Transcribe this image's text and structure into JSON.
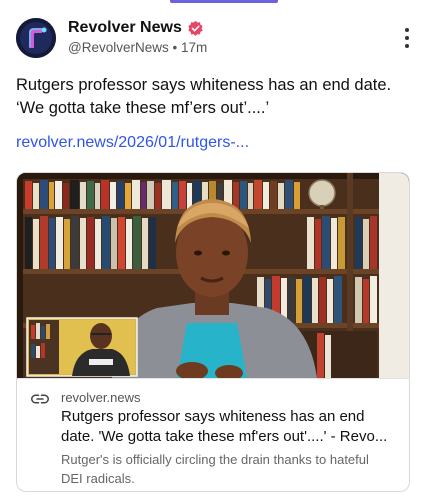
{
  "post": {
    "author_name": "Revolver News",
    "author_handle": "@RevolverNews",
    "separator": "•",
    "time_ago": "17m",
    "text_line1": "Rutgers professor says whiteness has an end date.",
    "text_line2": "‘We gotta take these mf’ers out’....’",
    "link_text": "revolver.news/2026/01/rutgers-..."
  },
  "link_card": {
    "domain": "revolver.news",
    "title_line1": "Rutgers professor says whiteness has an end",
    "title_line2": "date. 'We gotta take these mf'ers out'....' - Revo...",
    "description_line1": "Rutger's is officially circling the drain thanks to hateful",
    "description_line2": "DEI radicals."
  },
  "colors": {
    "accent": "#6b63d9",
    "link": "#2f54eb",
    "verified_badge": "#e8456b"
  },
  "icons": [
    "avatar-logo",
    "verified-badge-icon",
    "more-options-icon",
    "link-icon"
  ]
}
